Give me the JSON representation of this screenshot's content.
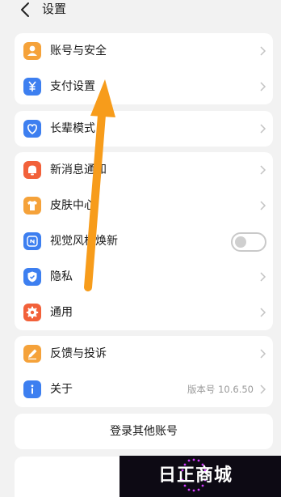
{
  "header": {
    "title": "设置"
  },
  "group1": [
    {
      "label": "账号与安全",
      "icon": "user-icon",
      "color": "#f5a23a"
    },
    {
      "label": "支付设置",
      "icon": "yen-icon",
      "color": "#3d7ff0"
    }
  ],
  "group2": [
    {
      "label": "长辈模式",
      "icon": "heart-icon",
      "color": "#3d7ff0"
    }
  ],
  "group3": [
    {
      "label": "新消息通知",
      "icon": "bell-icon",
      "color": "#f2613a"
    },
    {
      "label": "皮肤中心",
      "icon": "shirt-icon",
      "color": "#f5a23a"
    },
    {
      "label": "视觉风格焕新",
      "icon": "new-style-icon",
      "color": "#3d7ff0",
      "toggle": false
    },
    {
      "label": "隐私",
      "icon": "shield-icon",
      "color": "#3d7ff0"
    },
    {
      "label": "通用",
      "icon": "gear-icon",
      "color": "#f2613a"
    }
  ],
  "group4": [
    {
      "label": "反馈与投诉",
      "icon": "pen-icon",
      "color": "#f5a23a"
    },
    {
      "label": "关于",
      "icon": "info-icon",
      "color": "#3d7ff0",
      "value": "版本号 10.6.50"
    }
  ],
  "login_other": "登录其他账号",
  "watermark": "日正商城",
  "accent_arrow_color": "#f79c1b"
}
